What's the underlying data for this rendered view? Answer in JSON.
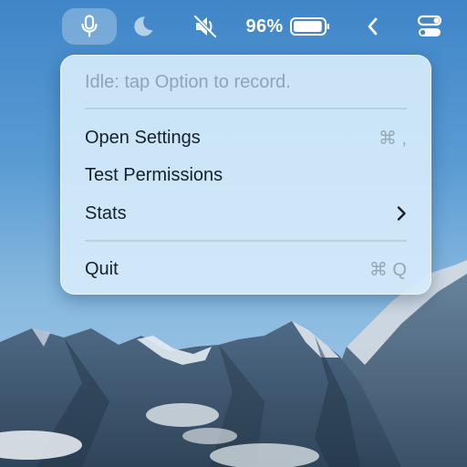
{
  "menubar": {
    "icons": [
      "microphone-icon",
      "moon-icon",
      "muted-speaker-icon",
      "battery-icon",
      "chevron-left-icon",
      "control-center-icon"
    ],
    "battery_percent": "96%",
    "battery_level": 0.96
  },
  "menu": {
    "status": "Idle: tap Option to record.",
    "items": [
      {
        "label": "Open Settings",
        "shortcut": "⌘ ,"
      },
      {
        "label": "Test Permissions",
        "shortcut": ""
      },
      {
        "label": "Stats",
        "submenu_icon": "chevron-right-icon"
      },
      {
        "label": "Quit",
        "shortcut": "⌘ Q"
      }
    ]
  },
  "colors": {
    "menu_background": "#d6ecfb",
    "menu_text": "#14212b",
    "menu_muted_text": "#8da5b6",
    "sky": "#4b8fcb"
  }
}
